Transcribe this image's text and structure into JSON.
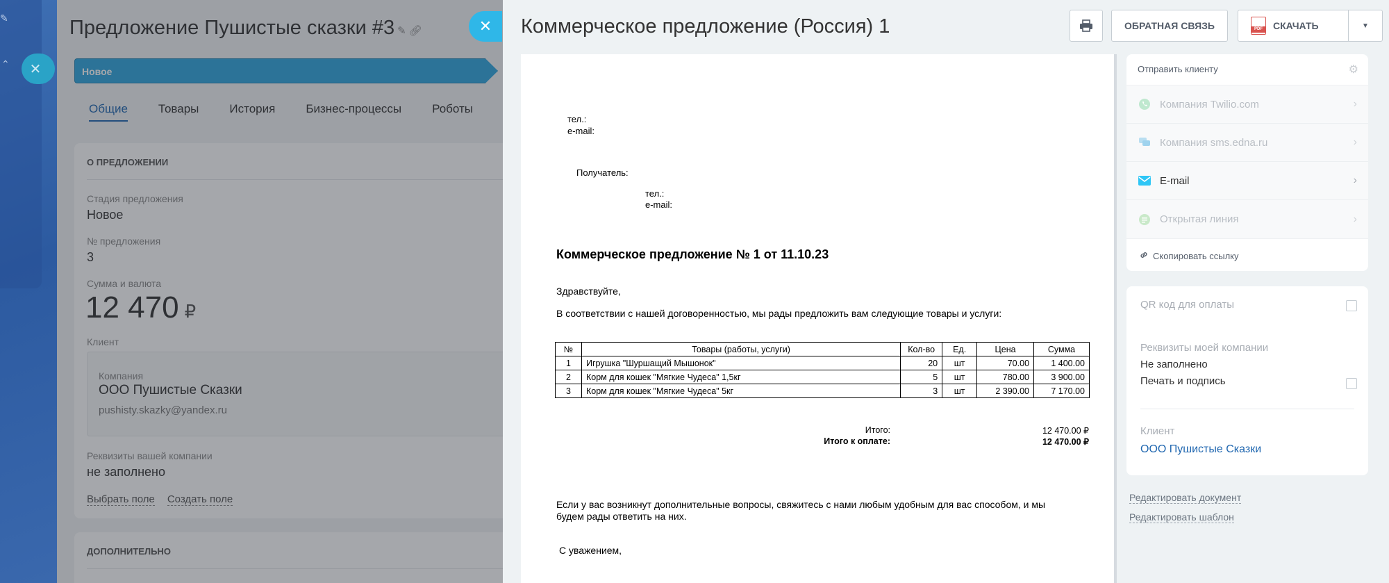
{
  "deal": {
    "title": "Предложение Пушистые сказки #3",
    "stage_bar": "Новое",
    "tabs": [
      "Общие",
      "Товары",
      "История",
      "Бизнес-процессы",
      "Роботы"
    ],
    "section_about": "О ПРЕДЛОЖЕНИИ",
    "stage_label": "Стадия предложения",
    "stage_value": "Новое",
    "number_label": "№ предложения",
    "number_value": "3",
    "sum_label": "Сумма и валюта",
    "sum_value": "12 470",
    "sum_currency": "₽",
    "client_label": "Клиент",
    "company_label": "Компания",
    "company_name": "ООО Пушистые Сказки",
    "company_email": "pushisty.skazky@yandex.ru",
    "requisites_label": "Реквизиты вашей компании",
    "requisites_value": "не заполнено",
    "choose_field": "Выбрать поле",
    "create_field": "Создать поле",
    "section_extra": "ДОПОЛНИТЕЛЬНО"
  },
  "slider": {
    "title": "Коммерческое предложение (Россия) 1",
    "feedback_button": "ОБРАТНАЯ СВЯЗЬ",
    "download_button": "СКАЧАТЬ",
    "pdf_badge": "PDF"
  },
  "document": {
    "sender_phone": "тел.:",
    "sender_email": "e-mail:",
    "recipient_label": "Получатель:",
    "recipient_phone": "тел.:",
    "recipient_email": "e-mail:",
    "heading": "Коммерческое предложение № 1 от 11.10.23",
    "greeting": "Здравствуйте,",
    "intro": "В соответствии с нашей договоренностью, мы рады предложить вам следующие товары и услуги:",
    "table_headers": [
      "№",
      "Товары (работы, услуги)",
      "Кол-во",
      "Ед.",
      "Цена",
      "Сумма"
    ],
    "rows": [
      [
        "1",
        "Игрушка \"Шуршащий Мышонок\"",
        "20",
        "шт",
        "70.00",
        "1 400.00"
      ],
      [
        "2",
        "Корм для кошек \"Мягкие Чудеса\" 1,5кг",
        "5",
        "шт",
        "780.00",
        "3 900.00"
      ],
      [
        "3",
        "Корм для кошек \"Мягкие Чудеса\" 5кг",
        "3",
        "шт",
        "2 390.00",
        "7 170.00"
      ]
    ],
    "total_label": "Итого:",
    "total_value": "12 470.00 ₽",
    "to_pay_label": "Итого к оплате:",
    "to_pay_value": "12 470.00 ₽",
    "closing_1": "Если у вас возникнут дополнительные вопросы, свяжитесь с нами любым удобным для вас способом, и мы",
    "closing_2": "будем рады ответить на них.",
    "regards": "С уважением,"
  },
  "send_panel": {
    "header": "Отправить клиенту",
    "channels": [
      {
        "label": "Компания Twilio.com",
        "icon": "whatsapp-icon",
        "active": false
      },
      {
        "label": "Компания sms.edna.ru",
        "icon": "sms-icon",
        "active": false
      },
      {
        "label": "E-mail",
        "icon": "email-icon",
        "active": true
      },
      {
        "label": "Открытая линия",
        "icon": "open-line-icon",
        "active": false
      }
    ],
    "copy_link": "Скопировать ссылку"
  },
  "info_panel": {
    "qr_label": "QR код для оплаты",
    "requisites_label": "Реквизиты моей компании",
    "requisites_value": "Не заполнено",
    "print_sign": "Печать и подпись",
    "client_label": "Клиент",
    "client_value": "ООО Пушистые Сказки"
  },
  "footer_links": {
    "edit_document": "Редактировать документ",
    "edit_template": "Редактировать шаблон"
  },
  "colors": {
    "accent": "#2fb7e8",
    "link": "#2067b0",
    "stage": "#2fa6de"
  }
}
